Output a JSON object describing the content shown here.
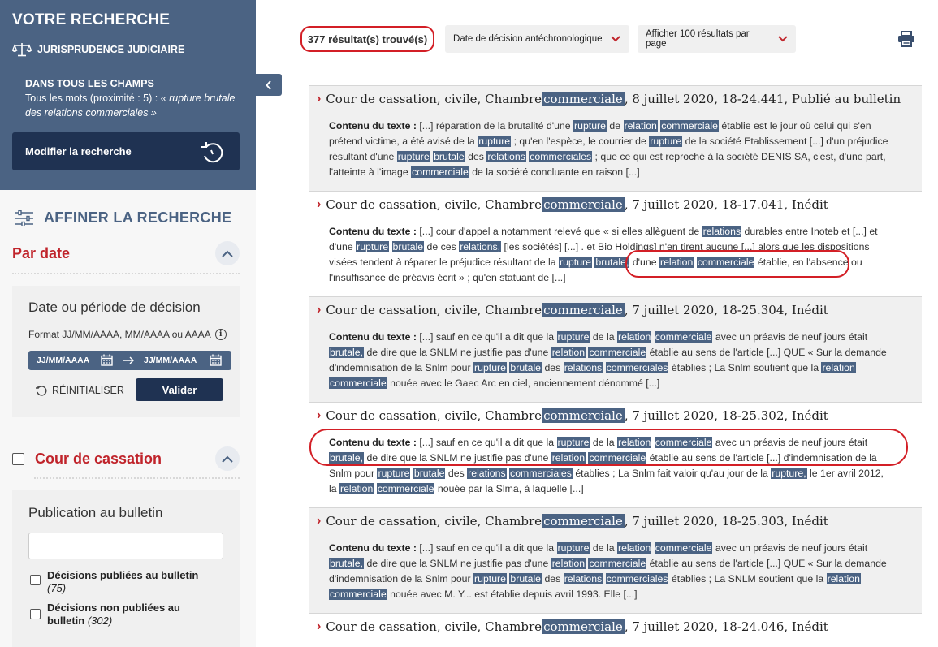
{
  "sidebar": {
    "title": "VOTRE RECHERCHE",
    "juris": "JURISPRUDENCE JUDICIAIRE",
    "fields_label": "DANS TOUS LES CHAMPS",
    "fields_prefix": "Tous les mots (proximité : 5)  : ",
    "fields_query": "« rupture brutale des relations commerciales »",
    "modify": "Modifier la recherche",
    "affiner": "AFFINER LA RECHERCHE",
    "par_date": "Par date",
    "date_panel_title": "Date ou période de décision",
    "date_format": "Format JJ/MM/AAAA, MM/AAAA ou AAAA",
    "date_from_ph": "JJ/MM/AAAA",
    "date_to_ph": "JJ/MM/AAAA",
    "reinit": "RÉINITIALISER",
    "valider": "Valider",
    "cour": "Cour de cassation",
    "pub_title": "Publication au bulletin",
    "pub_opts": [
      {
        "label": "Décisions publiées au bulletin",
        "count": "(75)"
      },
      {
        "label1": "Décisions non publiées au",
        "label2": "bulletin",
        "count": "(302)"
      }
    ]
  },
  "main": {
    "count": "377 résultat(s) trouvé(s)",
    "sort": "Date de décision antéchronologique",
    "per_page": "Afficher 100 résultats par page"
  },
  "results": [
    {
      "title_pre": "Cour de cassation, civile, Chambre ",
      "hl": "commerciale",
      "title_post": ", 8 juillet 2020, 18-24.441, Publié au bulletin"
    },
    {
      "title_pre": "Cour de cassation, civile, Chambre ",
      "hl": "commerciale",
      "title_post": ", 7 juillet 2020, 18-17.041, Inédit"
    },
    {
      "title_pre": "Cour de cassation, civile, Chambre ",
      "hl": "commerciale",
      "title_post": ", 7 juillet 2020, 18-25.304, Inédit"
    },
    {
      "title_pre": "Cour de cassation, civile, Chambre ",
      "hl": "commerciale",
      "title_post": ", 7 juillet 2020, 18-25.302, Inédit"
    },
    {
      "title_pre": "Cour de cassation, civile, Chambre ",
      "hl": "commerciale",
      "title_post": ", 7 juillet 2020, 18-25.303, Inédit"
    },
    {
      "title_pre": "Cour de cassation, civile, Chambre ",
      "hl": "commerciale",
      "title_post": ", 7 juillet 2020, 18-24.046, Inédit"
    }
  ],
  "snippets": {
    "label": "Contenu du texte :",
    "r1": [
      "[...] réparation de la brutalité d'une ",
      "rupture",
      " de ",
      "relation",
      " ",
      "commerciale",
      " établie est le jour où celui qui s'en prétend victime, a été avisé de la ",
      "rupture",
      " ; qu'en l'espèce, le courrier de ",
      "rupture",
      " de la société Etablissement [...] d'un préjudice résultant d'une ",
      "rupture",
      " ",
      "brutale",
      " des ",
      "relations",
      " ",
      "commerciales",
      " ; que ce qui est reproché à la société DENIS SA, c'est, d'une part, l'atteinte à l'image ",
      "commerciale",
      " de la société concluante en raison [...]"
    ],
    "r2": [
      "[...] cour d'appel a notamment relevé que « si elles allèguent de ",
      "relations",
      " durables entre Inoteb et [...] et d'une ",
      "rupture",
      " ",
      "brutale",
      " de ces ",
      "relations,",
      " [les sociétés] [...] . et Bio Holdings] n'en tirent aucune [...] alors que les dispositions visées tendent à réparer le préjudice résultant de la ",
      "rupture",
      " ",
      "brutale,",
      " d'une ",
      "relation",
      " ",
      "commerciale",
      " établie, en l'absence ou l'insuffisance de préavis écrit » ; qu'en statuant de [...]"
    ],
    "r3": [
      "[...] sauf en ce qu'il a dit que la ",
      "rupture",
      " de la ",
      "relation",
      " ",
      "commerciale",
      " avec un préavis de neuf jours était ",
      "brutale,",
      " de dire que la SNLM ne justifie pas d'une ",
      "relation",
      " ",
      "commerciale",
      " établie au sens de l'article [...] QUE « Sur la demande d'indemnisation de la Snlm pour ",
      "rupture",
      " ",
      "brutale",
      " des ",
      "relations",
      " ",
      "commerciales",
      " établies ; La Snlm soutient que la ",
      "relation",
      " ",
      "commerciale",
      " nouée avec le Gaec Arc en ciel, anciennement dénommé [...]"
    ],
    "r4": [
      "[...] sauf en ce qu'il a dit que la ",
      "rupture",
      " de la ",
      "relation",
      " ",
      "commerciale",
      " avec un préavis de neuf jours était ",
      "brutale,",
      " de dire que la SNLM ne justifie pas d'une ",
      "relation",
      " ",
      "commerciale",
      " établie au sens de l'article [...] d'indemnisation de la Snlm pour ",
      "rupture",
      " ",
      "brutale",
      " des ",
      "relations",
      " ",
      "commerciales",
      " établies ; La Snlm fait valoir qu'au jour de la ",
      "rupture,",
      " le 1er avril 2012, la ",
      "relation",
      " ",
      "commerciale",
      " nouée par la Slma, à laquelle [...]"
    ],
    "r5": [
      "[...] sauf en ce qu'il a dit que la ",
      "rupture",
      " de la ",
      "relation",
      " ",
      "commerciale",
      " avec un préavis de neuf jours était ",
      "brutale,",
      " de dire que la SNLM ne justifie pas d'une ",
      "relation",
      " ",
      "commerciale",
      " établie au sens de l'article [...] QUE « Sur la demande d'indemnisation de la Snlm pour ",
      "rupture",
      " ",
      "brutale",
      " des ",
      "relations",
      " ",
      "commerciales",
      " établies ; La SNLM soutient que la ",
      "relation",
      " ",
      "commerciale",
      " nouée avec M. Y... est établie depuis avril 1993. Elle [...]"
    ]
  },
  "colors": {
    "brand": "#4b6383",
    "dark": "#1f3252",
    "accent": "#c0242b",
    "annot": "#d31f26"
  }
}
